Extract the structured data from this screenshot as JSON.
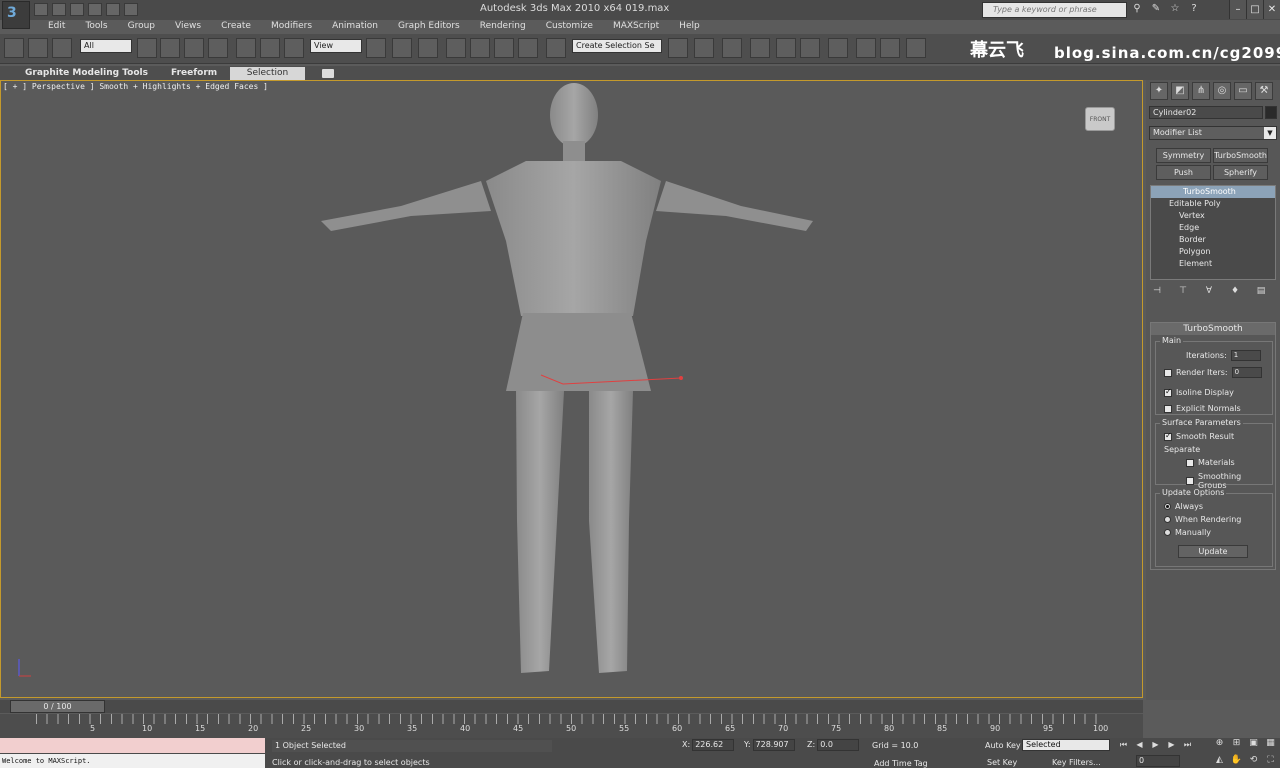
{
  "window": {
    "title": "Autodesk 3ds Max  2010 x64      019.max",
    "search_placeholder": "Type a keyword or phrase",
    "logo_glyph": "3"
  },
  "menu": [
    "Edit",
    "Tools",
    "Group",
    "Views",
    "Create",
    "Modifiers",
    "Animation",
    "Graph Editors",
    "Rendering",
    "Customize",
    "MAXScript",
    "Help"
  ],
  "toolbar": {
    "selection_filter": "All",
    "ref_coord": "View",
    "named_selection": "Create Selection Se"
  },
  "watermark": {
    "chinese": "幕云飞",
    "blog": "blog.sina.com.cn/cg2099"
  },
  "ribbon": {
    "tabs": [
      "Graphite Modeling Tools",
      "Freeform",
      "Selection"
    ],
    "active": "Selection"
  },
  "viewport": {
    "label": "[ + ] Perspective ] Smooth + Highlights + Edged Faces ]",
    "viewcube": "FRONT",
    "accent": "#c49a2c"
  },
  "command_panel": {
    "object_name": "Cylinder02",
    "modifier_list": "Modifier List",
    "mod_buttons": [
      "Symmetry",
      "TurboSmooth",
      "Push",
      "Spherify"
    ],
    "stack": [
      "TurboSmooth",
      "Editable Poly",
      "Vertex",
      "Edge",
      "Border",
      "Polygon",
      "Element"
    ],
    "rollout_title": "TurboSmooth",
    "main_label": "Main",
    "iterations_label": "Iterations:",
    "iterations_value": "1",
    "render_iters_label": "Render Iters:",
    "render_iters_value": "0",
    "isoline": "Isoline Display",
    "explicit_normals": "Explicit Normals",
    "surface_params": "Surface Parameters",
    "smooth_result": "Smooth Result",
    "separate": "Separate",
    "materials": "Materials",
    "smoothing_groups": "Smoothing Groups",
    "update_options": "Update Options",
    "always": "Always",
    "when_rendering": "When Rendering",
    "manually": "Manually",
    "update_button": "Update"
  },
  "timeline": {
    "slider": "0 / 100",
    "ticks": [
      "5",
      "10",
      "15",
      "20",
      "25",
      "30",
      "35",
      "40",
      "45",
      "50",
      "55",
      "60",
      "65",
      "70",
      "75",
      "80",
      "85",
      "90",
      "95",
      "100"
    ]
  },
  "status": {
    "listener": "Welcome to MAXScript.",
    "selected": "1 Object Selected",
    "prompt": "Click or click-and-drag to select objects",
    "x_label": "X:",
    "x_value": "226.62",
    "y_label": "Y:",
    "y_value": "728.907",
    "z_label": "Z:",
    "z_value": "0.0",
    "grid": "Grid = 10.0",
    "add_time_tag": "Add Time Tag",
    "auto_key": "Auto Key",
    "selected_dropdown": "Selected",
    "set_key": "Set Key",
    "key_filters": "Key Filters...",
    "frame": "0"
  }
}
